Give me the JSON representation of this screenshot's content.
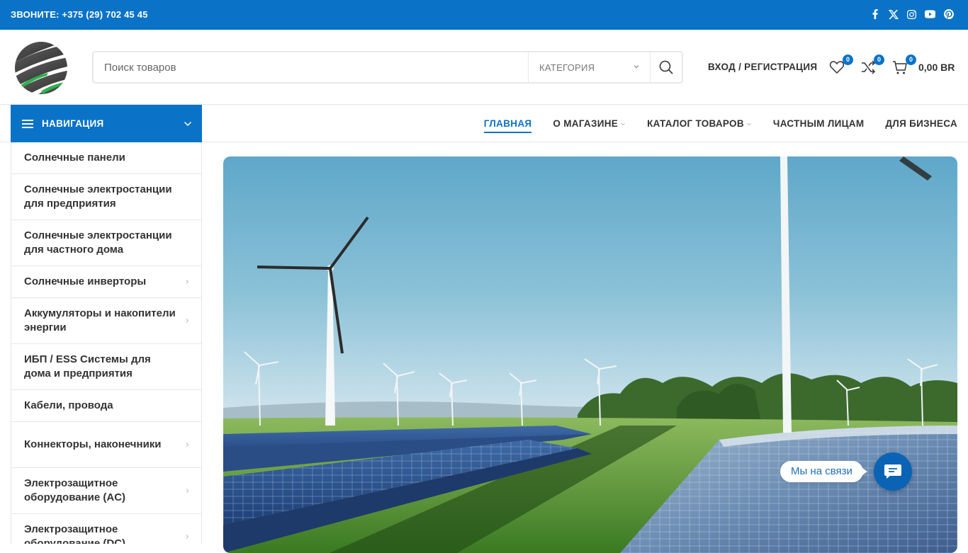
{
  "topbar": {
    "phone": "ЗВОНИТЕ: +375 (29) 702 45 45",
    "socials": [
      "facebook-icon",
      "x-icon",
      "instagram-icon",
      "youtube-icon",
      "pinterest-icon"
    ]
  },
  "header": {
    "search_placeholder": "Поиск товаров",
    "category_label": "КАТЕГОРИЯ",
    "login_label": "ВХОД / РЕГИСТРАЦИЯ",
    "wishlist_count": "0",
    "compare_count": "0",
    "cart_count": "0",
    "cart_total": "0,00 BR"
  },
  "catnav": {
    "title": "НАВИГАЦИЯ",
    "items": [
      {
        "label": "Солнечные панели",
        "has_sub": false
      },
      {
        "label": "Солнечные электростанции для предприятия",
        "has_sub": false
      },
      {
        "label": "Солнечные электростанции для частного дома",
        "has_sub": false
      },
      {
        "label": "Солнечные инверторы",
        "has_sub": true
      },
      {
        "label": "Аккумуляторы и накопители энергии",
        "has_sub": true
      },
      {
        "label": "ИБП / ESS Системы для дома и предприятия",
        "has_sub": false
      },
      {
        "label": "Кабели, провода",
        "has_sub": false
      },
      {
        "label": "Коннекторы, наконечники",
        "has_sub": true
      },
      {
        "label": "Электрозащитное оборудование (AC)",
        "has_sub": true
      },
      {
        "label": "Электрозащитное оборудование (DC)",
        "has_sub": true
      }
    ]
  },
  "mainmenu": {
    "items": [
      {
        "label": "ГЛАВНАЯ",
        "active": true,
        "dropdown": false
      },
      {
        "label": "О МАГАЗИНЕ",
        "active": false,
        "dropdown": true
      },
      {
        "label": "КАТАЛОГ ТОВАРОВ",
        "active": false,
        "dropdown": true
      },
      {
        "label": "ЧАСТНЫМ ЛИЦАМ",
        "active": false,
        "dropdown": false
      },
      {
        "label": "ДЛЯ БИЗНЕСА",
        "active": false,
        "dropdown": false
      }
    ]
  },
  "chat": {
    "label": "Мы на связи"
  },
  "colors": {
    "accent": "#0a73c7",
    "text": "#333333",
    "border": "#e6e6e6"
  }
}
